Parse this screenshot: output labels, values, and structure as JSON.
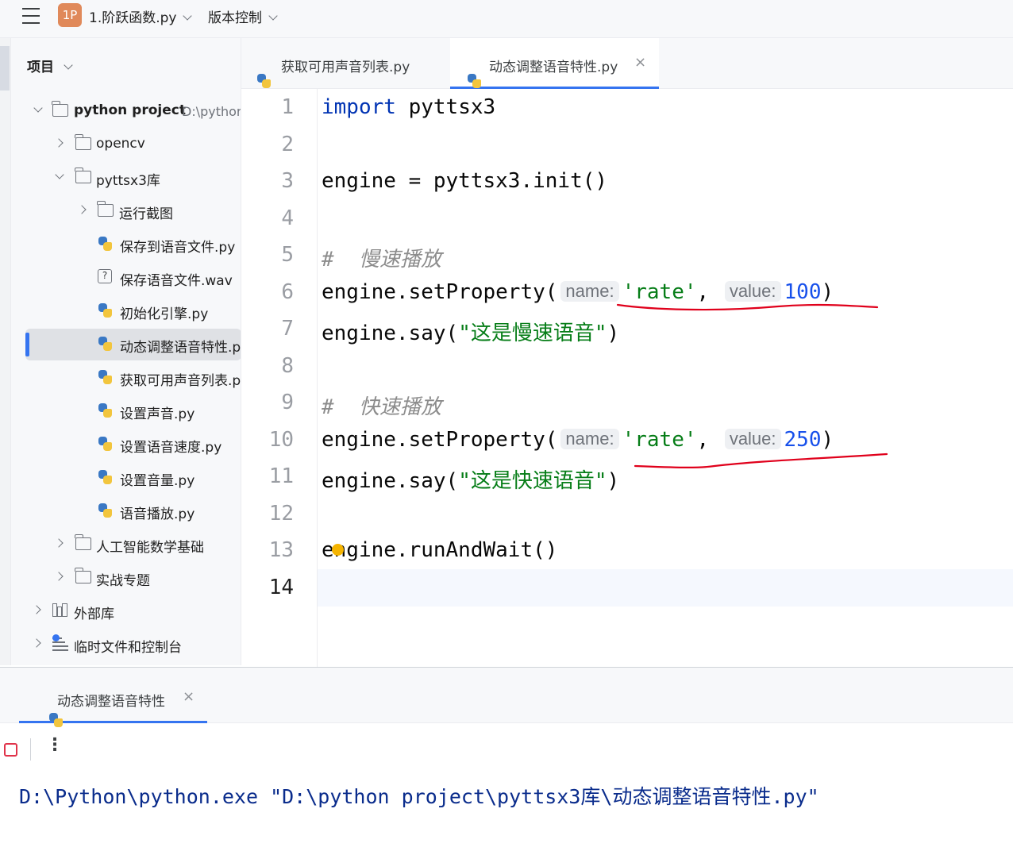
{
  "titlebar": {
    "project_badge": "1P",
    "project_name": "1.阶跃函数.py",
    "vcs_label": "版本控制"
  },
  "project_panel": {
    "header": "项目",
    "tree": [
      {
        "label": "python project",
        "hint": "D:\\pythor",
        "type": "folder",
        "depth": 0,
        "state": "expanded"
      },
      {
        "label": "opencv",
        "type": "folder",
        "depth": 1,
        "state": "collapsed"
      },
      {
        "label": "pyttsx3库",
        "type": "folder",
        "depth": 1,
        "state": "expanded"
      },
      {
        "label": "运行截图",
        "type": "folder",
        "depth": 2,
        "state": "collapsed"
      },
      {
        "label": "保存到语音文件.py",
        "type": "python",
        "depth": 3
      },
      {
        "label": "保存语音文件.wav",
        "type": "unknown",
        "depth": 3
      },
      {
        "label": "初始化引擎.py",
        "type": "python",
        "depth": 3
      },
      {
        "label": "动态调整语音特性.p",
        "type": "python",
        "depth": 3,
        "selected": true
      },
      {
        "label": "获取可用声音列表.p",
        "type": "python",
        "depth": 3
      },
      {
        "label": "设置声音.py",
        "type": "python",
        "depth": 3
      },
      {
        "label": "设置语音速度.py",
        "type": "python",
        "depth": 3
      },
      {
        "label": "设置音量.py",
        "type": "python",
        "depth": 3
      },
      {
        "label": "语音播放.py",
        "type": "python",
        "depth": 3
      },
      {
        "label": "人工智能数学基础",
        "type": "folder",
        "depth": 1,
        "state": "collapsed"
      },
      {
        "label": "实战专题",
        "type": "folder",
        "depth": 1,
        "state": "collapsed"
      },
      {
        "label": "外部库",
        "type": "library",
        "depth": 0,
        "state": "collapsed"
      },
      {
        "label": "临时文件和控制台",
        "type": "scratch",
        "depth": 0,
        "state": "collapsed"
      }
    ]
  },
  "editor": {
    "tabs": [
      {
        "label": "获取可用声音列表.py",
        "active": false
      },
      {
        "label": "动态调整语音特性.py",
        "active": true
      }
    ],
    "current_line": 14,
    "lines": [
      {
        "n": "1",
        "code": "import pyttsx3"
      },
      {
        "n": "2",
        "code": ""
      },
      {
        "n": "3",
        "code": "engine = pyttsx3.init()"
      },
      {
        "n": "4",
        "code": ""
      },
      {
        "n": "5",
        "code": "# 慢速播放"
      },
      {
        "n": "6",
        "code": "engine.setProperty( name: 'rate',  value: 100)"
      },
      {
        "n": "7",
        "code": "engine.say(\"这是慢速语音\")"
      },
      {
        "n": "8",
        "code": ""
      },
      {
        "n": "9",
        "code": "# 快速播放"
      },
      {
        "n": "10",
        "code": "engine.setProperty( name: 'rate',  value: 250)"
      },
      {
        "n": "11",
        "code": "engine.say(\"这是快速语音\")"
      },
      {
        "n": "12",
        "code": ""
      },
      {
        "n": "13",
        "code": "engine.runAndWait()"
      },
      {
        "n": "14",
        "code": ""
      }
    ],
    "tokens": {
      "import_kw": "import",
      "module": " pyttsx3",
      "engine_assign": "engine = pyttsx3.init()",
      "comment_slow": "#  慢速播放",
      "comment_fast": "#  快速播放",
      "set_prop": "engine.setProperty(",
      "hint_name": "name:",
      "rate_str": "'rate'",
      "comma": ",",
      "hint_value": "value:",
      "value_slow": "100",
      "value_fast": "250",
      "close_paren": ")",
      "say_open": "engine.say(",
      "say_slow": "\"这是慢速语音\"",
      "say_fast": "\"这是快速语音\"",
      "run_wait": "engine.runAndWait()"
    },
    "annotation_color": "#e0001b"
  },
  "run_panel": {
    "tab_label": "动态调整语音特性",
    "console_output": "D:\\Python\\python.exe \"D:\\python project\\pyttsx3库\\动态调整语音特性.py\""
  },
  "colors": {
    "accent": "#3574f0",
    "keyword": "#0033b3",
    "string": "#067d17",
    "number": "#1750eb",
    "comment": "#8c8c8c",
    "stop": "#e0334a"
  }
}
